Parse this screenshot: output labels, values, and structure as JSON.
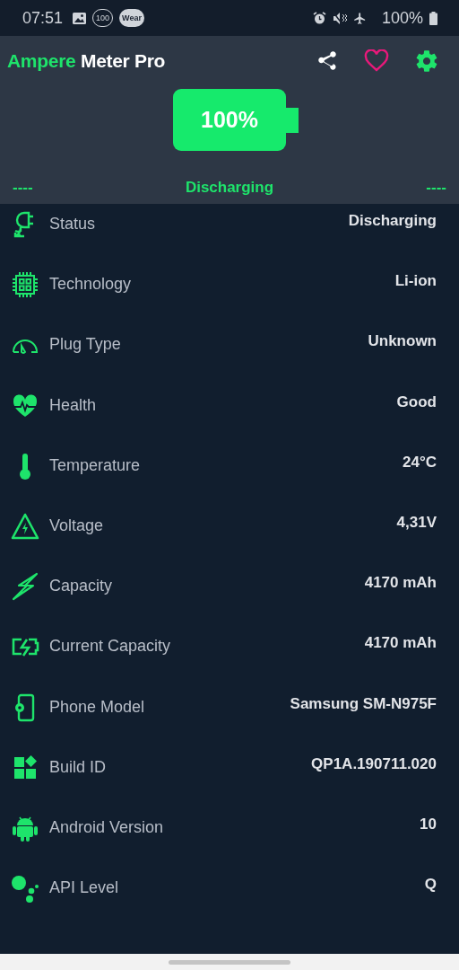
{
  "status_bar": {
    "time": "07:51",
    "notif_badge": "100",
    "wear_badge": "Wear",
    "battery": "100%"
  },
  "app_bar": {
    "title_accent": "Ampere",
    "title_rest": "Meter Pro"
  },
  "battery": {
    "percent": "100%"
  },
  "state_line": {
    "left": "----",
    "center": "Discharging",
    "right": "----"
  },
  "rows": [
    {
      "kind": "plug",
      "label": "Status",
      "value": "Discharging"
    },
    {
      "kind": "chip",
      "label": "Technology",
      "value": "Li-ion"
    },
    {
      "kind": "gauge",
      "label": "Plug Type",
      "value": "Unknown"
    },
    {
      "kind": "heart",
      "label": "Health",
      "value": "Good"
    },
    {
      "kind": "thermometer",
      "label": "Temperature",
      "value": "24°C"
    },
    {
      "kind": "warning",
      "label": "Voltage",
      "value": "4,31V"
    },
    {
      "kind": "bolt",
      "label": "Capacity",
      "value": "4170 mAh"
    },
    {
      "kind": "battery",
      "label": "Current Capacity",
      "value": "4170 mAh"
    },
    {
      "kind": "phone",
      "label": "Phone Model",
      "value": "Samsung SM-N975F"
    },
    {
      "kind": "blocks",
      "label": "Build ID",
      "value": "QP1A.190711.020"
    },
    {
      "kind": "android",
      "label": "Android Version",
      "value": "10"
    },
    {
      "kind": "dots",
      "label": "API Level",
      "value": "Q"
    }
  ]
}
